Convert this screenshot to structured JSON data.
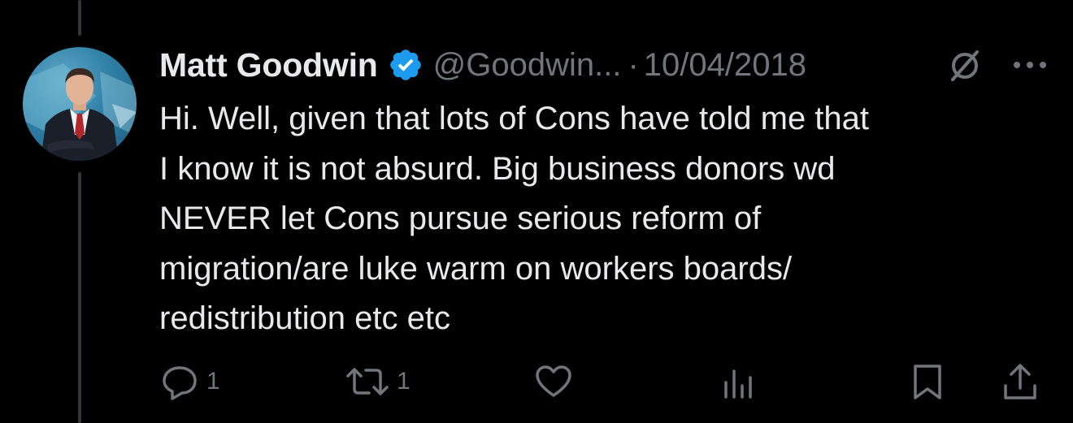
{
  "tweet": {
    "author_name": "Matt Goodwin",
    "handle": "@Goodwin...",
    "separator": "·",
    "date": "10/04/2018",
    "text": "Hi. Well, given that lots of Cons have told me that\nI know it is not absurd. Big business donors wd\nNEVER let Cons pursue serious reform of\nmigration/are luke warm on workers boards/\nredistribution etc etc"
  },
  "actions": {
    "reply_count": "1",
    "retweet_count": "1",
    "like_count": "",
    "views_count": ""
  },
  "icons": {
    "verified": "verified-badge-icon",
    "edit": "edit-history-icon",
    "more": "more-options-icon",
    "reply": "reply-icon",
    "retweet": "retweet-icon",
    "like": "like-icon",
    "views": "views-icon",
    "bookmark": "bookmark-icon",
    "share": "share-icon"
  },
  "colors": {
    "background": "#000000",
    "text_primary": "#e7e9ea",
    "text_secondary": "#71767b",
    "verified_blue": "#1d9bf0",
    "thread_line": "#333639"
  }
}
